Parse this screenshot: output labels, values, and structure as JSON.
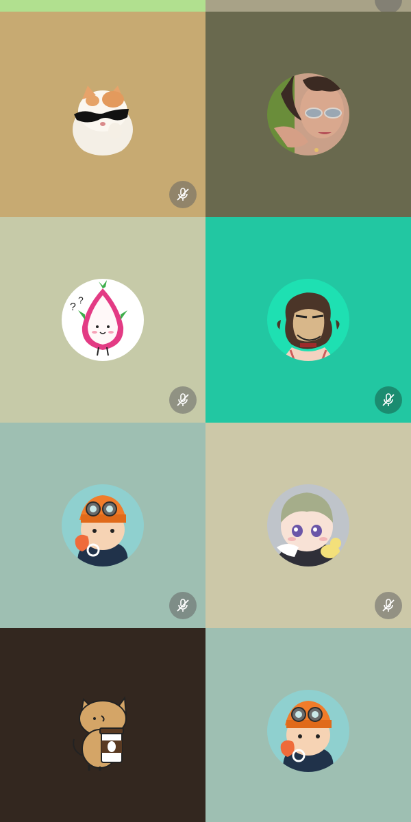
{
  "call": {
    "participants": [
      {
        "name": "",
        "tile_color": "#b1e08f",
        "muted": false,
        "avatar": "partial-top",
        "row": "partial"
      },
      {
        "name": "",
        "tile_color": "#a8a287",
        "muted": true,
        "avatar": "partial-top",
        "row": "partial"
      },
      {
        "name": "",
        "tile_color": "#c7aa72",
        "muted": true,
        "avatar": "cat-with-sunglasses"
      },
      {
        "name": "",
        "tile_color": "#69694e",
        "muted": false,
        "avatar": "woman-with-sunglasses"
      },
      {
        "name": "",
        "tile_color": "#c6caa8",
        "muted": true,
        "avatar": "dragonfruit-character"
      },
      {
        "name": "",
        "tile_color": "#22c7a2",
        "muted": true,
        "avatar": "ape-cartoon"
      },
      {
        "name": "",
        "tile_color": "#9ebfb2",
        "muted": true,
        "avatar": "boy-with-goggles"
      },
      {
        "name": "",
        "tile_color": "#ccc8a8",
        "muted": true,
        "avatar": "anime-baby-with-duck"
      },
      {
        "name": "",
        "tile_color": "#33271f",
        "muted": false,
        "avatar": "cat-holding-coffee"
      },
      {
        "name": "",
        "tile_color": "#9ebfb2",
        "muted": false,
        "avatar": "boy-with-goggles"
      }
    ],
    "mute_icon_bg": "rgba(100,100,100,0.55)",
    "mute_icon_bg_teal": "#1b8c70"
  }
}
